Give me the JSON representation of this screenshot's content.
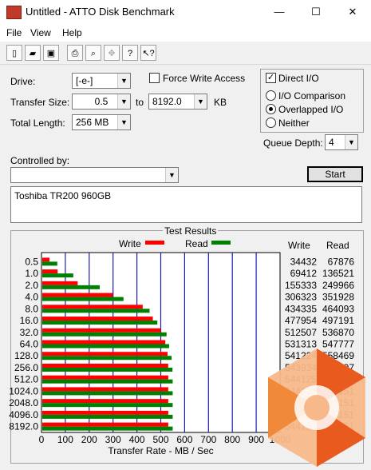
{
  "window": {
    "title": "Untitled - ATTO Disk Benchmark",
    "minimize": "—",
    "maximize": "☐",
    "close": "✕"
  },
  "menu": [
    "File",
    "View",
    "Help"
  ],
  "toolbar_icons": [
    "new-file-icon",
    "open-folder-icon",
    "save-icon",
    "print-icon",
    "print-preview-icon",
    "move-icon",
    "help-icon",
    "context-help-icon"
  ],
  "controls": {
    "drive_label": "Drive:",
    "drive_value": "[-e-]",
    "transfer_size_label": "Transfer Size:",
    "transfer_from": "0.5",
    "to_label": "to",
    "transfer_to": "8192.0",
    "kb_label": "KB",
    "total_length_label": "Total Length:",
    "total_length_value": "256 MB",
    "force_write_access_label": "Force Write Access",
    "force_write_access": false,
    "direct_io_label": "Direct I/O",
    "direct_io": true,
    "io_comparison_label": "I/O Comparison",
    "overlapped_io_label": "Overlapped I/O",
    "neither_label": "Neither",
    "selected_io_mode": "Overlapped I/O",
    "queue_depth_label": "Queue Depth:",
    "queue_depth_value": "4",
    "controlled_by_label": "Controlled by:",
    "controlled_by_value": "",
    "start_label": "Start",
    "description": "Toshiba TR200 960GB"
  },
  "results": {
    "title": "Test Results",
    "write_col": "Write",
    "read_col": "Read"
  },
  "chart_data": {
    "type": "bar",
    "orientation": "horizontal",
    "title": "",
    "xlabel": "Transfer Rate - MB / Sec",
    "xlim": [
      0,
      1000
    ],
    "xticks": [
      "0",
      "100",
      "200",
      "300",
      "400",
      "500",
      "600",
      "700",
      "800",
      "900",
      "1000"
    ],
    "categories": [
      "0.5",
      "1.0",
      "2.0",
      "4.0",
      "8.0",
      "16.0",
      "32.0",
      "64.0",
      "128.0",
      "256.0",
      "512.0",
      "1024.0",
      "2048.0",
      "4096.0",
      "8192.0"
    ],
    "series": [
      {
        "name": "Write",
        "color": "#ff0000",
        "values": [
          34432,
          69412,
          155333,
          306323,
          434335,
          477954,
          512507,
          531313,
          541224,
          543934,
          544125,
          544125,
          544125,
          544125,
          544125
        ]
      },
      {
        "name": "Read",
        "color": "#008000",
        "values": [
          67876,
          136521,
          249966,
          351928,
          464093,
          497191,
          536870,
          547777,
          558469,
          562397,
          563151,
          563151,
          563151,
          563151,
          563151
        ]
      }
    ],
    "value_unit_note": "KB/s values; bars scaled to MB/s axis",
    "grid": true,
    "legend": "top"
  },
  "colors": {
    "write": "#ff0000",
    "read": "#008000",
    "grid": "#1c1cb4"
  }
}
